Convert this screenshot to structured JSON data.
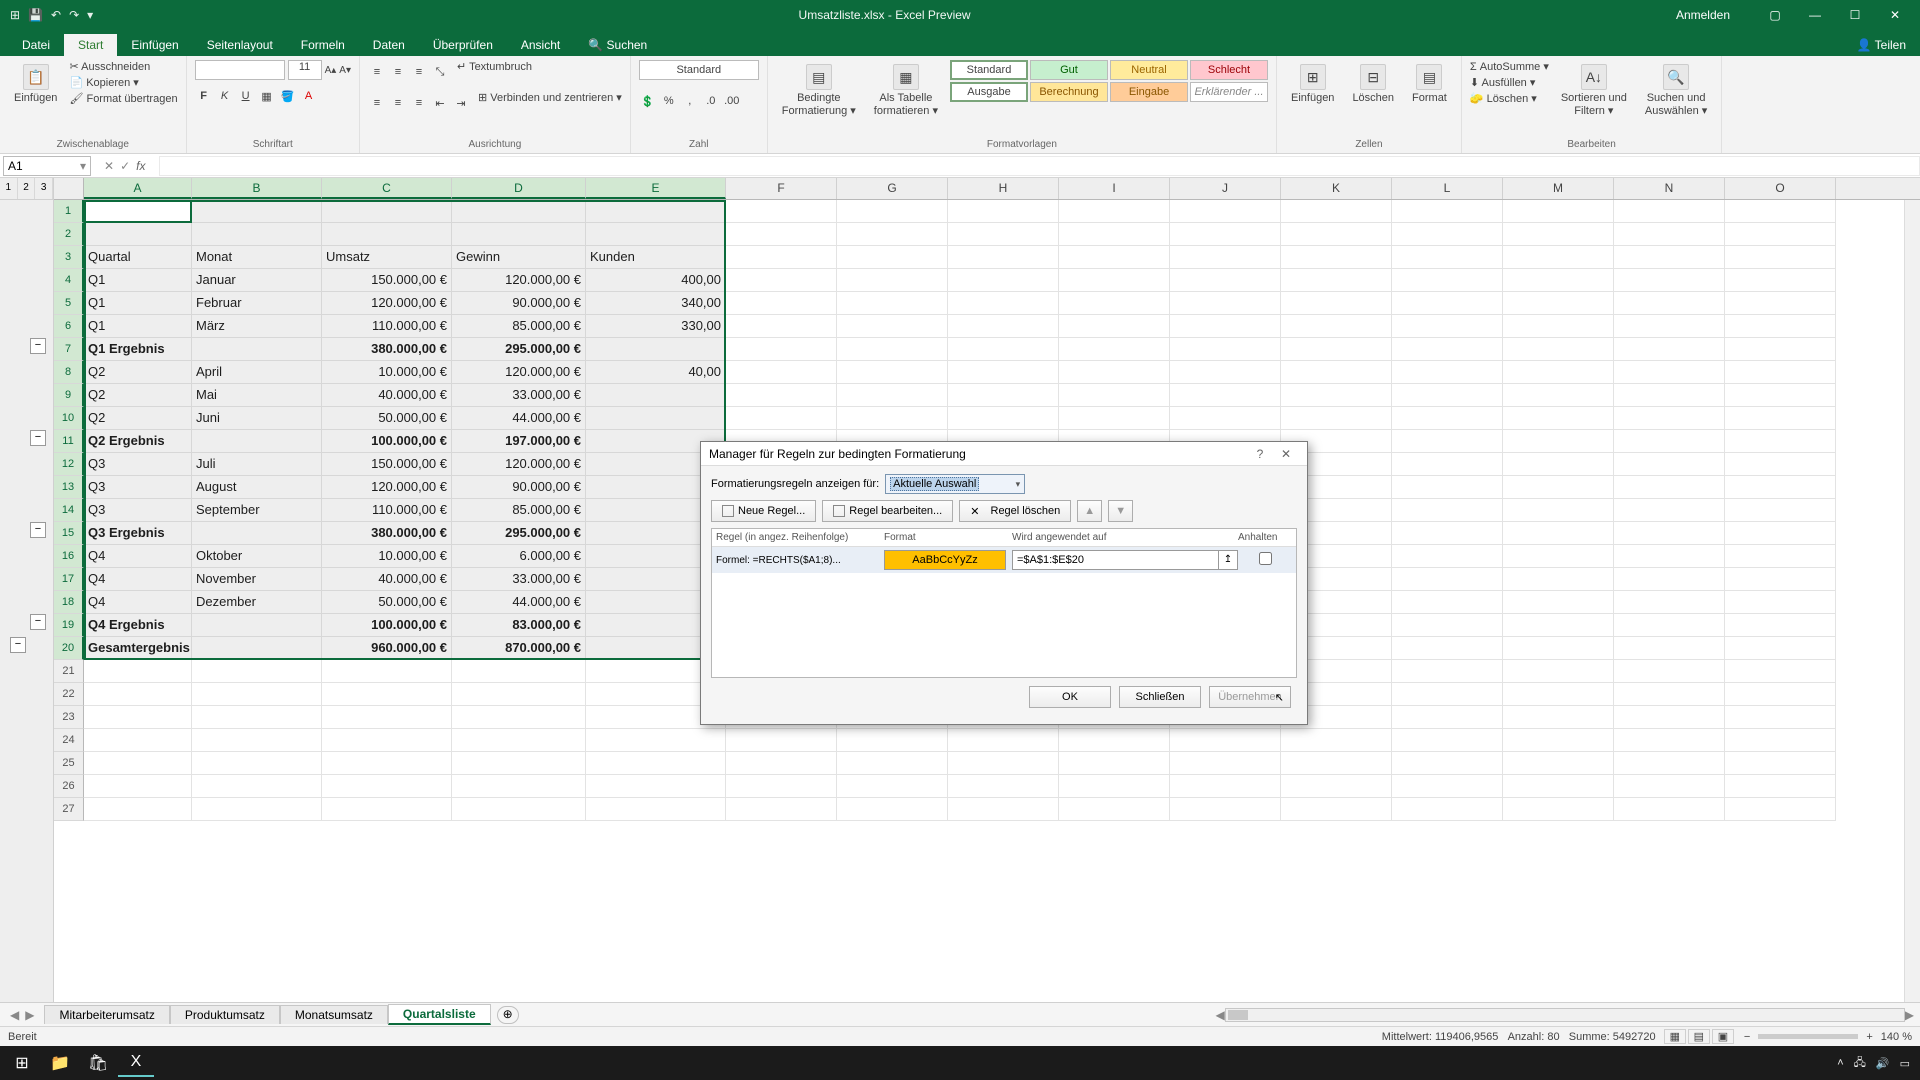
{
  "titlebar": {
    "title": "Umsatzliste.xlsx - Excel Preview",
    "signin": "Anmelden"
  },
  "tabs": {
    "datei": "Datei",
    "start": "Start",
    "einfuegen": "Einfügen",
    "seitenlayout": "Seitenlayout",
    "formeln": "Formeln",
    "daten": "Daten",
    "ueberpruefen": "Überprüfen",
    "ansicht": "Ansicht",
    "suchen": "Suchen",
    "teilen": "Teilen"
  },
  "ribbon": {
    "paste": "Einfügen",
    "clip_cut": "Ausschneiden",
    "clip_copy": "Kopieren ▾",
    "clip_format": "Format übertragen",
    "group_clip": "Zwischenablage",
    "font_size": "11",
    "group_font": "Schriftart",
    "wrap": "Textumbruch",
    "merge": "Verbinden und zentrieren ▾",
    "group_align": "Ausrichtung",
    "numfmt": "Standard",
    "group_num": "Zahl",
    "condfmt": "Bedingte\nFormatierung ▾",
    "astable": "Als Tabelle\nformatieren ▾",
    "style_standard": "Standard",
    "style_gut": "Gut",
    "style_neutral": "Neutral",
    "style_schlecht": "Schlecht",
    "style_ausgabe": "Ausgabe",
    "style_berechnung": "Berechnung",
    "style_eingabe": "Eingabe",
    "style_erk": "Erklärender ...",
    "group_styles": "Formatvorlagen",
    "insert": "Einfügen",
    "delete": "Löschen",
    "format": "Format",
    "group_cells": "Zellen",
    "autosum": "AutoSumme ▾",
    "fill": "Ausfüllen ▾",
    "clear": "Löschen ▾",
    "sortfilter": "Sortieren und\nFiltern ▾",
    "find": "Suchen und\nAuswählen ▾",
    "group_edit": "Bearbeiten"
  },
  "namebox": "A1",
  "columns": [
    "A",
    "B",
    "C",
    "D",
    "E",
    "F",
    "G",
    "H",
    "I",
    "J",
    "K",
    "L",
    "M",
    "N",
    "O"
  ],
  "outline": {
    "levels": [
      "1",
      "2",
      "3"
    ],
    "collapse": [
      "−",
      "−",
      "−",
      "−",
      "−"
    ]
  },
  "sheet": {
    "headers": [
      "Quartal",
      "Monat",
      "Umsatz",
      "Gewinn",
      "Kunden"
    ],
    "rows": [
      [
        "Q1",
        "Januar",
        "150.000,00 €",
        "120.000,00 €",
        "400,00"
      ],
      [
        "Q1",
        "Februar",
        "120.000,00 €",
        "90.000,00 €",
        "340,00"
      ],
      [
        "Q1",
        "März",
        "110.000,00 €",
        "85.000,00 €",
        "330,00"
      ],
      [
        "Q1 Ergebnis",
        "",
        "380.000,00 €",
        "295.000,00 €",
        ""
      ],
      [
        "Q2",
        "April",
        "10.000,00 €",
        "120.000,00 €",
        "40,00"
      ],
      [
        "Q2",
        "Mai",
        "40.000,00 €",
        "33.000,00 €",
        ""
      ],
      [
        "Q2",
        "Juni",
        "50.000,00 €",
        "44.000,00 €",
        ""
      ],
      [
        "Q2 Ergebnis",
        "",
        "100.000,00 €",
        "197.000,00 €",
        ""
      ],
      [
        "Q3",
        "Juli",
        "150.000,00 €",
        "120.000,00 €",
        ""
      ],
      [
        "Q3",
        "August",
        "120.000,00 €",
        "90.000,00 €",
        ""
      ],
      [
        "Q3",
        "September",
        "110.000,00 €",
        "85.000,00 €",
        ""
      ],
      [
        "Q3 Ergebnis",
        "",
        "380.000,00 €",
        "295.000,00 €",
        ""
      ],
      [
        "Q4",
        "Oktober",
        "10.000,00 €",
        "6.000,00 €",
        ""
      ],
      [
        "Q4",
        "November",
        "40.000,00 €",
        "33.000,00 €",
        ""
      ],
      [
        "Q4",
        "Dezember",
        "50.000,00 €",
        "44.000,00 €",
        ""
      ],
      [
        "Q4 Ergebnis",
        "",
        "100.000,00 €",
        "83.000,00 €",
        ""
      ],
      [
        "Gesamtergebnis",
        "",
        "960.000,00 €",
        "870.000,00 €",
        ""
      ]
    ],
    "bold_rows": [
      3,
      7,
      11,
      15,
      16
    ]
  },
  "sheettabs": [
    "Mitarbeiterumsatz",
    "Produktumsatz",
    "Monatsumsatz",
    "Quartalsliste"
  ],
  "status": {
    "ready": "Bereit",
    "avg_label": "Mittelwert:",
    "avg": "119406,9565",
    "count_label": "Anzahl:",
    "count": "80",
    "sum_label": "Summe:",
    "sum": "5492720",
    "zoom": "140 %"
  },
  "dialog": {
    "title": "Manager für Regeln zur bedingten Formatierung",
    "show_for": "Formatierungsregeln anzeigen für:",
    "show_for_value": "Aktuelle Auswahl",
    "new_rule": "Neue Regel...",
    "edit_rule": "Regel bearbeiten...",
    "del_rule": "Regel löschen",
    "col_rule": "Regel (in angez. Reihenfolge)",
    "col_format": "Format",
    "col_applies": "Wird angewendet auf",
    "col_stop": "Anhalten",
    "rule_formula": "Formel: =RECHTS($A1;8)...",
    "rule_preview": "AaBbCcYyZz",
    "rule_range": "=$A$1:$E$20",
    "ok": "OK",
    "close": "Schließen",
    "apply": "Übernehmen"
  }
}
